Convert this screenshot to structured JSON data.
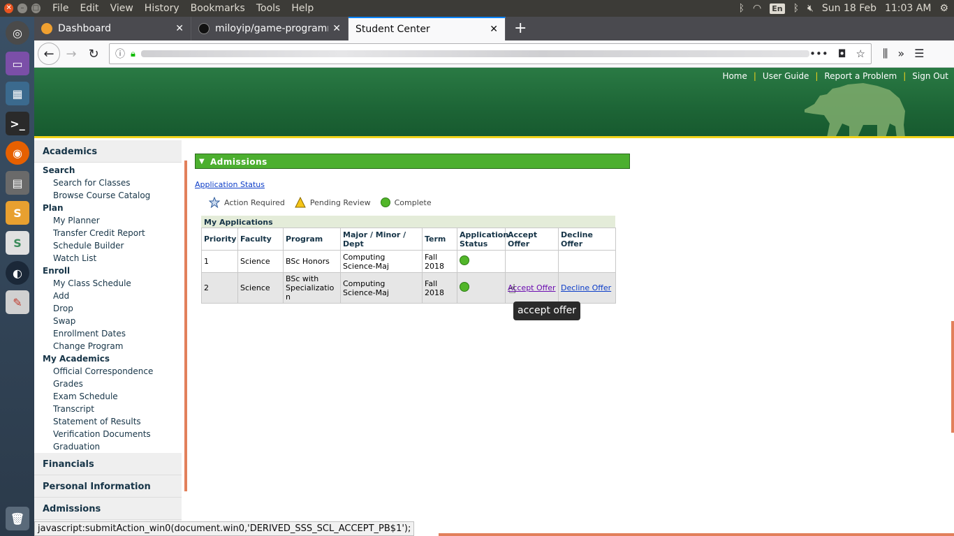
{
  "os": {
    "menu": [
      "File",
      "Edit",
      "View",
      "History",
      "Bookmarks",
      "Tools",
      "Help"
    ],
    "lang": "En",
    "date": "Sun 18 Feb",
    "time": "11:03 AM"
  },
  "browser": {
    "tabs": [
      {
        "title": "Dashboard",
        "fav_color": "#f0a030"
      },
      {
        "title": "miloyip/game-programmer",
        "fav_color": "#111111"
      },
      {
        "title": "Student Center",
        "fav_color": "#f9f9fa"
      }
    ]
  },
  "header": {
    "links": [
      "Home",
      "User Guide",
      "Report a Problem",
      "Sign Out"
    ]
  },
  "sidebar": {
    "sections_top": "Academics",
    "groups": [
      {
        "label": "Search",
        "items": [
          "Search for Classes",
          "Browse Course Catalog"
        ]
      },
      {
        "label": "Plan",
        "items": [
          "My Planner",
          "Transfer Credit Report",
          "Schedule Builder",
          "Watch List"
        ]
      },
      {
        "label": "Enroll",
        "items": [
          "My Class Schedule",
          "Add",
          "Drop",
          "Swap",
          "Enrollment Dates",
          "Change Program"
        ]
      },
      {
        "label": "My Academics",
        "items": [
          "Official Correspondence",
          "Grades",
          "Exam Schedule",
          "Transcript",
          "Statement of Results",
          "Verification Documents",
          "Graduation"
        ]
      }
    ],
    "sections_bottom": [
      "Financials",
      "Personal Information",
      "Admissions"
    ]
  },
  "content": {
    "section_title": "Admissions",
    "app_status_link": "Application Status",
    "legend": [
      "Action Required",
      "Pending Review",
      "Complete"
    ],
    "grid_title": "My Applications",
    "columns": [
      "Priority",
      "Faculty",
      "Program",
      "Major / Minor / Dept",
      "Term",
      "Application Status",
      "Accept Offer",
      "Decline Offer"
    ],
    "rows": [
      {
        "priority": "1",
        "faculty": "Science",
        "program": "BSc Honors",
        "major": "Computing Science-Maj",
        "term": "Fall 2018",
        "accept": "",
        "decline": ""
      },
      {
        "priority": "2",
        "faculty": "Science",
        "program": "BSc with Specializatio n",
        "major": "Computing Science-Maj",
        "term": "Fall 2018",
        "accept": "Accept Offer",
        "decline": "Decline Offer"
      }
    ],
    "tooltip": "accept offer"
  },
  "status_bar": "javascript:submitAction_win0(document.win0,'DERIVED_SSS_SCL_ACCEPT_PB$1');"
}
